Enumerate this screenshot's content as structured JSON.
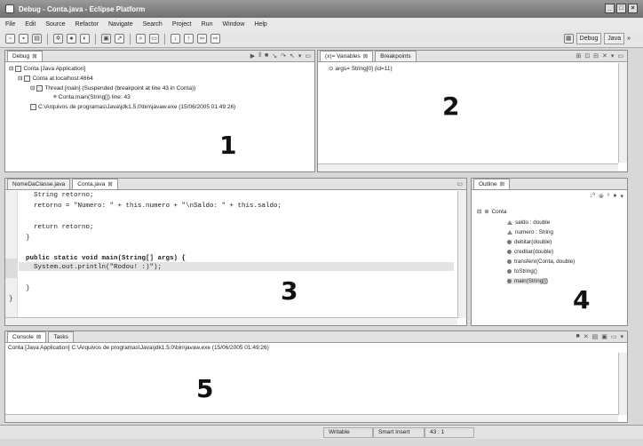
{
  "window": {
    "title": "Debug - Conta.java - Eclipse Platform",
    "controls": [
      "_",
      "□",
      "×"
    ]
  },
  "menu": [
    "File",
    "Edit",
    "Source",
    "Refactor",
    "Navigate",
    "Search",
    "Project",
    "Run",
    "Window",
    "Help"
  ],
  "perspectives": {
    "debug": "Debug",
    "java": "Java",
    "more": "»"
  },
  "debug_panel": {
    "tab": "Debug",
    "tree": [
      "Conta [Java Application]",
      "Conta at localhost:4664",
      "Thread [main] (Suspended (breakpoint at line 43 in Conta))",
      "Conta.main(String[]) line: 43",
      "C:\\Arquivos de programas\\Java\\jdk1.5.0\\bin\\javaw.exe (15/06/2005 01:49:26)"
    ],
    "number": "1"
  },
  "variables_panel": {
    "tabs": [
      "(x)= Variables",
      "Breakpoints"
    ],
    "row": "args= String[0]  (id=11)",
    "number": "2"
  },
  "editor": {
    "tabs": [
      "NomeDaClasse.java",
      "Conta.java"
    ],
    "lines": [
      "    String retorno;",
      "    retorno = \"Numero: \" + this.numero + \"\\nSaldo: \" + this.saldo;",
      "",
      "    return retorno;",
      "  }",
      "",
      "  public static void main(String[] args) {",
      "    System.out.println(\"Rodou! :)\");",
      "",
      "  }",
      "}"
    ],
    "number": "3"
  },
  "outline": {
    "tab": "Outline",
    "root": "Conta",
    "items": [
      "saldo : double",
      "numero : String",
      "debitar(double)",
      "creditar(double)",
      "transferir(Conta, double)",
      "toString()",
      "main(String[])"
    ],
    "number": "4"
  },
  "console": {
    "tabs": [
      "Console",
      "Tasks"
    ],
    "line": "Conta [Java Application] C:\\Arquivos de programas\\Java\\jdk1.5.0\\bin\\javaw.exe (15/06/2005 01:49:26)",
    "number": "5"
  },
  "status": {
    "mode": "Writable",
    "insert": "Smart Insert",
    "position": "43 : 1"
  }
}
